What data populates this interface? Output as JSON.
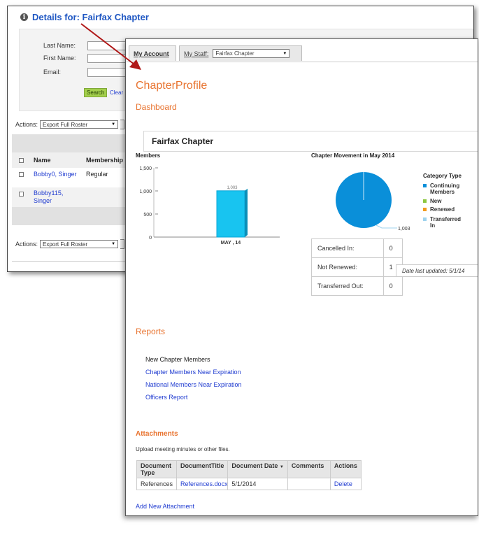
{
  "back": {
    "title": "Details for: Fairfax Chapter",
    "form": {
      "last_name_label": "Last Name:",
      "first_name_label": "First Name:",
      "email_label": "Email:",
      "search_button": "Search",
      "clear_link": "Clear"
    },
    "actions_label": "Actions:",
    "actions_select": "Export Full Roster",
    "columns": [
      "Name",
      "Membership"
    ],
    "rows": [
      {
        "name": "Bobby0, Singer",
        "membership": "Regular"
      },
      {
        "name": "Bobby115, Singer",
        "membership": ""
      }
    ]
  },
  "front": {
    "tabs": {
      "my_account": "My Account",
      "my_staff": "My Staff:",
      "staff_select": "Fairfax Chapter"
    },
    "page_title": "ChapterProfile",
    "dashboard_heading": "Dashboard",
    "chapter_name": "Fairfax Chapter",
    "stats": [
      {
        "label": "Cancelled In:",
        "value": "0"
      },
      {
        "label": "Not Renewed:",
        "value": "1"
      },
      {
        "label": "Transferred Out:",
        "value": "0"
      }
    ],
    "date_updated": "Date last updated: 5/1/14",
    "reports_heading": "Reports",
    "reports": {
      "plain": "New Chapter Members",
      "links": [
        "Chapter Members Near Expiration",
        "National Members Near Expiration",
        "Officers Report"
      ]
    },
    "attachments_heading": "Attachments",
    "attachments_note": "Upload meeting minutes or other files.",
    "attachments_columns": [
      "Document Type",
      "DocumentTitle",
      "Document Date",
      "Comments",
      "Actions"
    ],
    "attachments_rows": [
      {
        "type": "References",
        "title": "References.docx",
        "date": "5/1/2014",
        "comments": "",
        "action": "Delete"
      }
    ],
    "add_attachment": "Add New Attachment"
  },
  "chart_data": [
    {
      "type": "bar",
      "title": "Members",
      "categories": [
        "MAY , 14"
      ],
      "values": [
        1003
      ],
      "data_labels": [
        "1,003"
      ],
      "yticks": [
        "0",
        "500",
        "1,000",
        "1,500"
      ],
      "ylim": [
        0,
        1500
      ],
      "color": "#18c4f0"
    },
    {
      "type": "pie",
      "title": "Chapter Movement in May 2014",
      "legend_title": "Category Type",
      "labels": [
        "Continuing Members",
        "New",
        "Renewed",
        "Transferred In"
      ],
      "values": [
        1003,
        0,
        0,
        0
      ],
      "data_label": "1,003",
      "colors": [
        "#0a8fd9",
        "#8cc63f",
        "#f29a1e",
        "#9fd3ee"
      ],
      "legend_position": "right"
    }
  ]
}
